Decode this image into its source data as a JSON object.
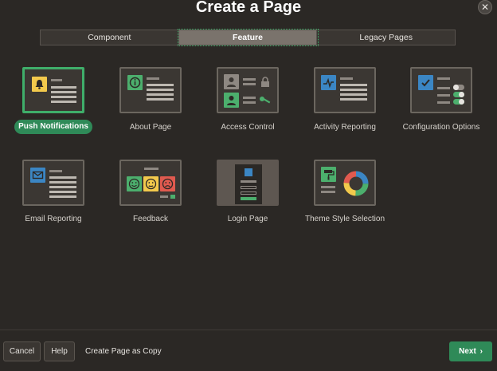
{
  "dialog": {
    "title": "Create a Page",
    "close_glyph": "✕"
  },
  "tabs": [
    {
      "label": "Component",
      "active": false
    },
    {
      "label": "Feature",
      "active": true
    },
    {
      "label": "Legacy Pages",
      "active": false
    }
  ],
  "features": [
    {
      "label": "Push Notifications",
      "icon": "bell-icon",
      "selected": true
    },
    {
      "label": "About Page",
      "icon": "info-icon",
      "selected": false
    },
    {
      "label": "Access Control",
      "icon": "user-lock-icon",
      "selected": false
    },
    {
      "label": "Activity Reporting",
      "icon": "activity-chart-icon",
      "selected": false
    },
    {
      "label": "Configuration Options",
      "icon": "checkbox-toggle-icon",
      "selected": false
    },
    {
      "label": "Email Reporting",
      "icon": "envelope-icon",
      "selected": false
    },
    {
      "label": "Feedback",
      "icon": "smiley-faces-icon",
      "selected": false
    },
    {
      "label": "Login Page",
      "icon": "login-form-icon",
      "selected": false
    },
    {
      "label": "Theme Style Selection",
      "icon": "paint-roller-donut-icon",
      "selected": false
    }
  ],
  "footer": {
    "cancel_label": "Cancel",
    "help_label": "Help",
    "copy_label": "Create Page as Copy",
    "next_label": "Next",
    "next_glyph": "›"
  },
  "colors": {
    "background": "#2b2825",
    "accent_green": "#2f8a58",
    "selection_outline": "#3fae6a",
    "tile_yellow": "#f2c94c",
    "tile_blue": "#3b86c4",
    "tile_green": "#4caf6d",
    "tile_red": "#e05a4f"
  }
}
